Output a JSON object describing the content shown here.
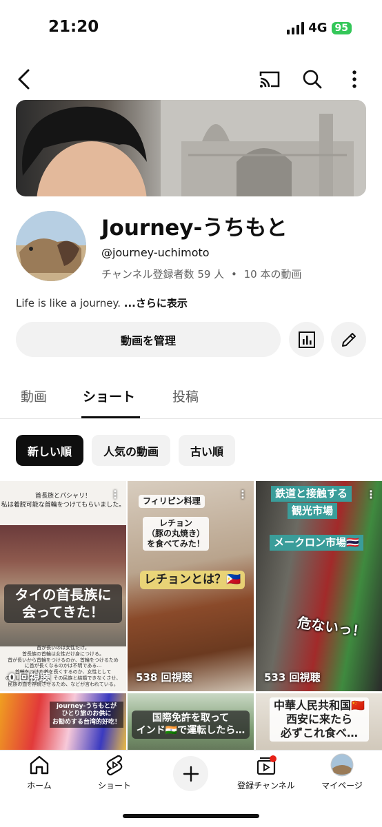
{
  "status_bar": {
    "time": "21:20",
    "network": "4G",
    "battery": "95"
  },
  "channel": {
    "name": "Journey-うちもと",
    "handle": "@journey-uchimoto",
    "subscribers": "チャンネル登録者数 59 人",
    "separator": "•",
    "video_count": "10 本の動画",
    "description": "Life is like a journey. ",
    "more_label": "...さらに表示"
  },
  "actions": {
    "manage_label": "動画を管理"
  },
  "tabs": [
    {
      "label": "動画",
      "active": false
    },
    {
      "label": "ショート",
      "active": true
    },
    {
      "label": "投稿",
      "active": false
    }
  ],
  "chips": [
    {
      "label": "新しい順",
      "active": true
    },
    {
      "label": "人気の動画",
      "active": false
    },
    {
      "label": "古い順",
      "active": false
    }
  ],
  "shorts": [
    {
      "top_text_1": "首長族とパシャリ！",
      "top_text_2": "私は着脱可能な首輪をつけてもらいました。",
      "caption": "タイの首長族に会ってきた！",
      "bottom_text_1": "首が長いのは女性だけ。",
      "bottom_text_2": "首長族の首輪は女性だけ身につける。",
      "bottom_text_3": "首が長いから首輪をつけるのか、首輪をつけるため",
      "bottom_text_4": "に首が長くなるのかは不明である…",
      "bottom_text_5": "首輪をつけた首を長くするのか、女性として",
      "bottom_text_6": "の美しさのためなど、その民族と結婚できなくさせ、",
      "bottom_text_7": "民族の血を存続させるため、などが言われている。",
      "views": "0 回視聴"
    },
    {
      "tag": "フィリピン料理",
      "sub": "レチョン\n（豚の丸焼き）\nを食べてみた！",
      "caption": "レチョンとは？🇵🇭",
      "views": "538 回視聴"
    },
    {
      "caption_1": "鉄道と接触する",
      "caption_2": "観光市場",
      "caption_3": "メークロン市場🇹🇭",
      "caption_4": "危ないっ！",
      "views": "533 回視聴"
    },
    {
      "caption_1": "journey-うちもとが",
      "caption_2": "ひとり旅のお供に",
      "caption_3": "お勧めする台湾的好吃！"
    },
    {
      "caption_1": "国際免許を取って",
      "caption_2": "インド🇮🇳で運転したら…"
    },
    {
      "caption_1": "中華人民共和国🇨🇳",
      "caption_2": "西安に来たら",
      "caption_3": "必ずこれ食べ…"
    }
  ],
  "bottom_nav": [
    {
      "label": "ホーム",
      "icon": "home-icon"
    },
    {
      "label": "ショート",
      "icon": "shorts-icon"
    },
    {
      "label": "",
      "icon": "plus-icon"
    },
    {
      "label": "登録チャンネル",
      "icon": "subscriptions-icon"
    },
    {
      "label": "マイページ",
      "icon": "avatar-icon"
    }
  ]
}
